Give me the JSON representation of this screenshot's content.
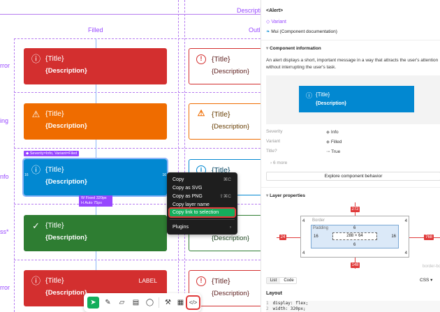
{
  "canvas": {
    "col_filled": "Filled",
    "col_outlined": "Outl",
    "top_desc": "Descripti",
    "row_labels": [
      "rror",
      "ing",
      "nfo",
      "ss*",
      "rror"
    ],
    "alerts": [
      {
        "title": "{Title}",
        "description": "{Description}",
        "color": "#d32f2f",
        "icon": "error-icon"
      },
      {
        "title": "{Title}",
        "description": "{Description}",
        "color": "#ef6c00",
        "icon": "warning-icon"
      },
      {
        "title": "{Title}",
        "description": "{Description}",
        "color": "#0288d1",
        "icon": "info-icon"
      },
      {
        "title": "{Title}",
        "description": "{Description}",
        "color": "#2e7d32",
        "icon": "success-icon"
      },
      {
        "title": "{Title}",
        "description": "{Description}",
        "color": "#d32f2f",
        "icon": "error-icon",
        "label": "LABEL"
      }
    ],
    "outlined": [
      {
        "title": "{Title}",
        "description": "{Description}",
        "color": "#d32f2f"
      },
      {
        "title": "{Title}",
        "description": "{Description}",
        "color": "#ef6c00"
      },
      {
        "title": "{Title}",
        "description": "",
        "color": "#0288d1"
      },
      {
        "title": "",
        "description": "{Description}",
        "color": "#2e7d32"
      },
      {
        "title": "{Title}",
        "description": "{Description}",
        "color": "#d32f2f"
      }
    ],
    "selection_tag": "◆ Severity=Info, Variant=Filed",
    "size_badge_w": "W Fixed 320px",
    "size_badge_h": "H Auto   75px",
    "sel_left": "16",
    "sel_right": "16"
  },
  "menu": {
    "items": [
      {
        "label": "Copy",
        "shortcut": "⌘C"
      },
      {
        "label": "Copy as SVG",
        "shortcut": ""
      },
      {
        "label": "Copy as PNG",
        "shortcut": "⇧⌘C"
      },
      {
        "label": "Copy layer name",
        "shortcut": ""
      },
      {
        "label": "Copy link to selection",
        "shortcut": ""
      },
      {
        "label": "Plugins",
        "shortcut": "›"
      }
    ]
  },
  "panel": {
    "component": "<Alert>",
    "variant": "Variant",
    "docs": "Mui (Component documentation)",
    "info_heading": "Component information",
    "info_text": "An alert displays a short, important message in a way that attracts the user's attention without interrupting the user's task.",
    "preview_title": "{Title}",
    "preview_desc": "{Description}",
    "props": [
      {
        "k": "Severity",
        "v": "Info"
      },
      {
        "k": "Variant",
        "v": "Filled"
      },
      {
        "k": "Title?",
        "v": "True"
      }
    ],
    "more": "6 more",
    "explore": "Explore component behavior",
    "layer_heading": "Layer properties",
    "border": "Border",
    "padding": "Padding",
    "size": "288 × 64",
    "m_top": "272",
    "m_left": "24",
    "m_right": "768",
    "m_bottom": "148",
    "b_val": "4",
    "p_top": "6",
    "p_bottom": "6",
    "p_left": "16",
    "p_right": "16",
    "border_box": "border-bo",
    "tabs": [
      "List",
      "Code"
    ],
    "css": "CSS",
    "layout": "Layout",
    "code": [
      "display: flex;",
      "width: 320px;"
    ]
  },
  "toolbar": {
    "icons": [
      "move-icon",
      "pen-icon",
      "ruler-icon",
      "text-icon",
      "comment-icon",
      "plugin-icon",
      "grid-icon",
      "code-icon"
    ]
  }
}
